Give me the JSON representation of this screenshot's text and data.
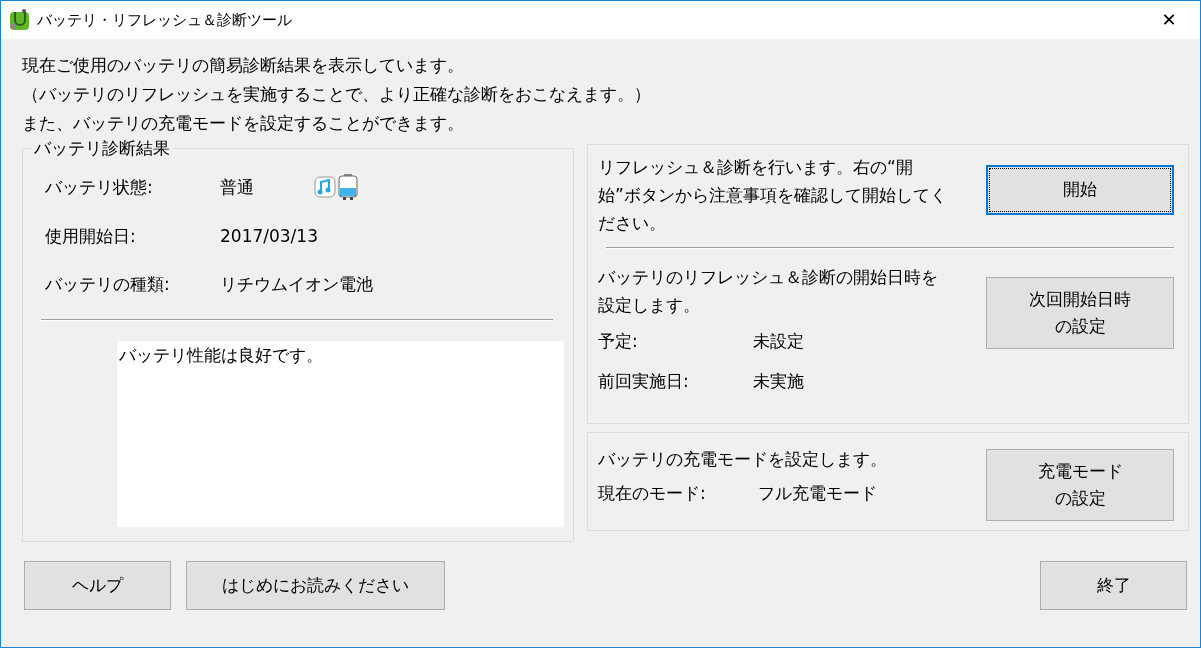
{
  "window": {
    "title": "バッテリ・リフレッシュ＆診断ツール",
    "close": "✕"
  },
  "intro_lines": [
    "現在ご使用のバッテリの簡易診断結果を表示しています。",
    "（バッテリのリフレッシュを実施することで、より正確な診断をおこなえます。）",
    "また、バッテリの充電モードを設定することができます。"
  ],
  "diagnosis": {
    "title": "バッテリ診断結果",
    "rows": [
      {
        "label": "バッテリ状態:",
        "value": "普通",
        "kind": "status"
      },
      {
        "label": "使用開始日:",
        "value": "2017/03/13",
        "kind": "plain"
      },
      {
        "label": "バッテリの種類:",
        "value": "リチウムイオン電池",
        "kind": "plain"
      }
    ],
    "message": "バッテリ性能は良好です。"
  },
  "refresh": {
    "text": "リフレッシュ＆診断を行います。右の“開始”ボタンから注意事項を確認して開始してください。",
    "button": {
      "lines": [
        "開始"
      ],
      "focused": true
    }
  },
  "schedule": {
    "text": "バッテリのリフレッシュ＆診断の開始日時を設定します。",
    "button": {
      "lines": [
        "次回開始日時",
        "の設定"
      ],
      "focused": false
    },
    "rows": [
      {
        "label": "予定:",
        "value": "未設定"
      },
      {
        "label": "前回実施日:",
        "value": "未実施"
      }
    ]
  },
  "charge": {
    "text": "バッテリの充電モードを設定します。",
    "button": {
      "lines": [
        "充電モード",
        "の設定"
      ],
      "focused": false
    },
    "rows": [
      {
        "label": "現在のモード:",
        "value": "フル充電モード"
      }
    ]
  },
  "bottom_buttons": [
    {
      "label": "ヘルプ",
      "kind": "left"
    },
    {
      "label": "はじめにお読みください",
      "kind": "left"
    },
    {
      "label": "終了",
      "kind": "right"
    }
  ]
}
